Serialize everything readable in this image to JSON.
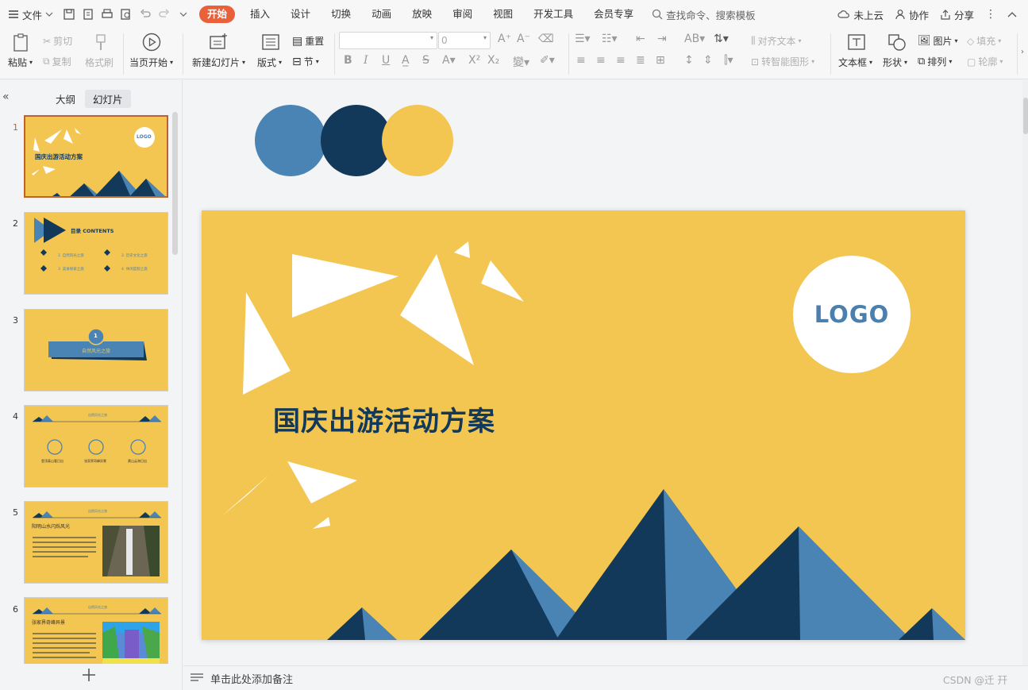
{
  "menu": {
    "file_label": "文件",
    "tabs": [
      "开始",
      "插入",
      "设计",
      "切换",
      "动画",
      "放映",
      "审阅",
      "视图",
      "开发工具",
      "会员专享"
    ],
    "search_placeholder": "查找命令、搜索模板",
    "cloud_label": "未上云",
    "collab_label": "协作",
    "share_label": "分享"
  },
  "ribbon": {
    "paste": "粘贴",
    "cut": "剪切",
    "copy": "复制",
    "format_painter": "格式刷",
    "play_from_current": "当页开始",
    "new_slide": "新建幻灯片",
    "layout": "版式",
    "reset": "重置",
    "section": "节",
    "font_size": "0",
    "align_text": "对齐文本",
    "smart_shape": "转智能图形",
    "textbox": "文本框",
    "shape": "形状",
    "picture": "图片",
    "arrange": "排列",
    "fill": "填充",
    "outline": "轮廓"
  },
  "panel": {
    "tab_outline": "大纲",
    "tab_slides": "幻灯片",
    "slide_numbers": [
      "1",
      "2",
      "3",
      "4",
      "5",
      "6"
    ],
    "thumbs": {
      "t1_title": "国庆出游活动方案",
      "t1_logo": "LOGO",
      "t2_title": "目录  CONTENTS",
      "t2_items": [
        "1. 自然风光之旅",
        "2. 历史文化之旅",
        "3. 美食探索之旅",
        "4. 休闲度假之旅"
      ],
      "t3_num": "1",
      "t3_title": "自然风光之旅",
      "t4_header": "自然风光之旅",
      "t4_items": [
        "登顶泰山看日出",
        "张家界奇峰异景",
        "黄山云海日出"
      ],
      "t5_header": "自然风光之旅",
      "t5_title": "阳明山水闪烁风光",
      "t6_header": "自然风光之旅",
      "t6_title": "张家界奇峰异景"
    }
  },
  "slide": {
    "title": "国庆出游活动方案",
    "logo": "LOGO"
  },
  "palette": [
    "#4a84b5",
    "#13395a",
    "#f3c551"
  ],
  "status": {
    "notes_placeholder": "单击此处添加备注",
    "watermark": "CSDN @迁  幵"
  }
}
